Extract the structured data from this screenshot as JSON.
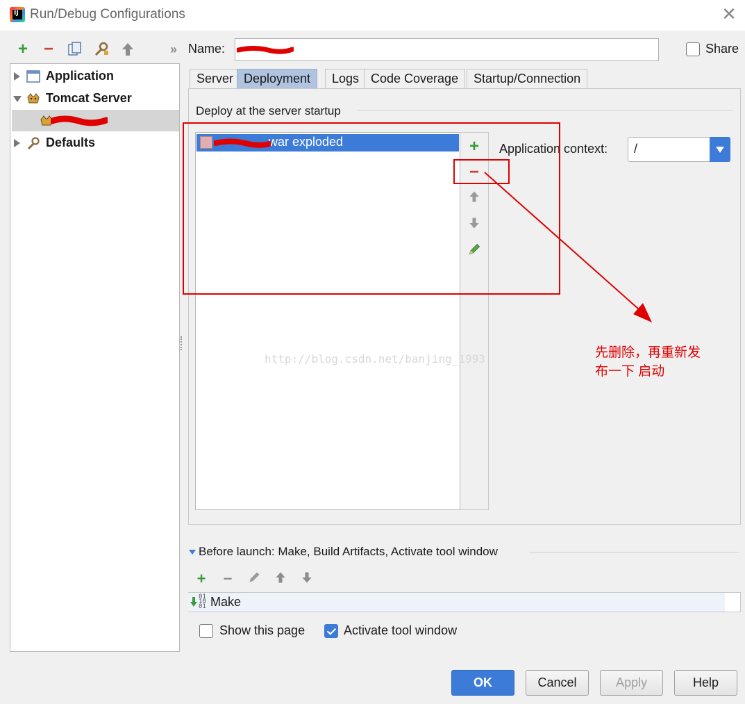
{
  "window": {
    "title": "Run/Debug Configurations",
    "app_icon_letters": "IJ"
  },
  "toolbar": {
    "add": "+",
    "remove": "−",
    "more": "»"
  },
  "tree": {
    "items": [
      {
        "label": "Application",
        "expanded": false
      },
      {
        "label": "Tomcat Server",
        "expanded": true
      },
      {
        "label": "Defaults",
        "expanded": false
      }
    ]
  },
  "name_field": {
    "label": "Name:",
    "value": ""
  },
  "share": {
    "label": "Share",
    "checked": false
  },
  "tabs": [
    {
      "label": "Server",
      "active": false
    },
    {
      "label": "Deployment",
      "active": true
    },
    {
      "label": "Logs",
      "active": false
    },
    {
      "label": "Code Coverage",
      "active": false
    },
    {
      "label": "Startup/Connection",
      "active": false
    }
  ],
  "deployment": {
    "section_title": "Deploy at the server startup",
    "artifacts": [
      {
        "label": "war exploded",
        "selected": true
      }
    ],
    "tools": {
      "add": "+",
      "remove": "−"
    },
    "context_label": "Application context:",
    "context_value": "/"
  },
  "annotation": {
    "text_line1": "先删除，再重新发",
    "text_line2": "布一下 启动",
    "color": "#e00000"
  },
  "watermark": "http://blog.csdn.net/banjing_1993",
  "before_launch": {
    "label": "Before launch: Make, Build Artifacts, Activate tool window",
    "items": [
      {
        "label": "Make",
        "icon_text": "01 10 01"
      }
    ]
  },
  "options": {
    "show_page": {
      "label": "Show this page",
      "checked": false
    },
    "activate_tool_window": {
      "label": "Activate tool window",
      "checked": true
    }
  },
  "buttons": {
    "ok": "OK",
    "cancel": "Cancel",
    "apply": "Apply",
    "help": "Help"
  },
  "colors": {
    "accent": "#3d7bd8",
    "add_green": "#3a9b3a",
    "remove_red": "#cf3e2e"
  }
}
